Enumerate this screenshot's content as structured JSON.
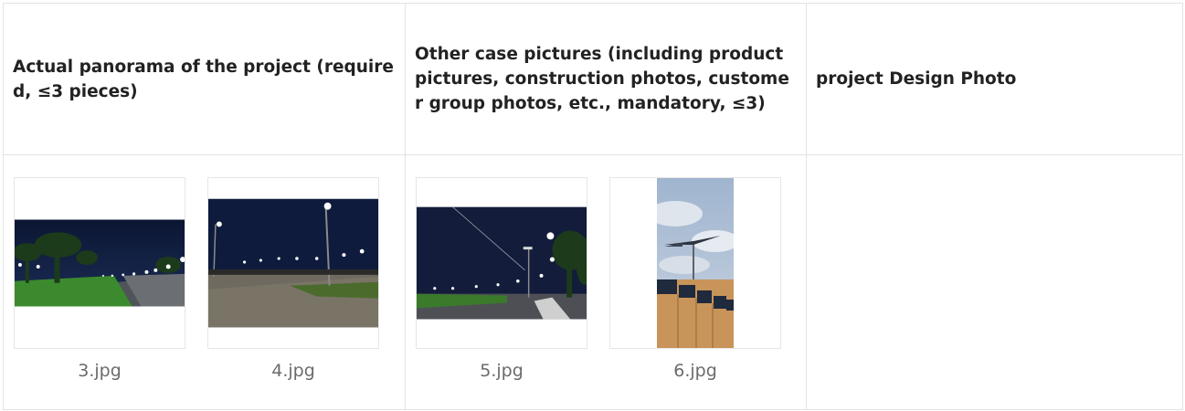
{
  "headers": {
    "col1": "Actual panorama of the project (required, ≤3 pieces)",
    "col2": "Other case pictures (including product pictures, construction photos, customer group photos, etc., mandatory, ≤3)",
    "col3": "project Design Photo"
  },
  "panorama_images": [
    {
      "filename": "3.jpg",
      "icon": "photo-street-lights-palms"
    },
    {
      "filename": "4.jpg",
      "icon": "photo-parking-lot-lights"
    }
  ],
  "case_images": [
    {
      "filename": "5.jpg",
      "icon": "photo-road-lights-night"
    },
    {
      "filename": "6.jpg",
      "icon": "photo-solar-street-lamp"
    }
  ],
  "design_images": []
}
